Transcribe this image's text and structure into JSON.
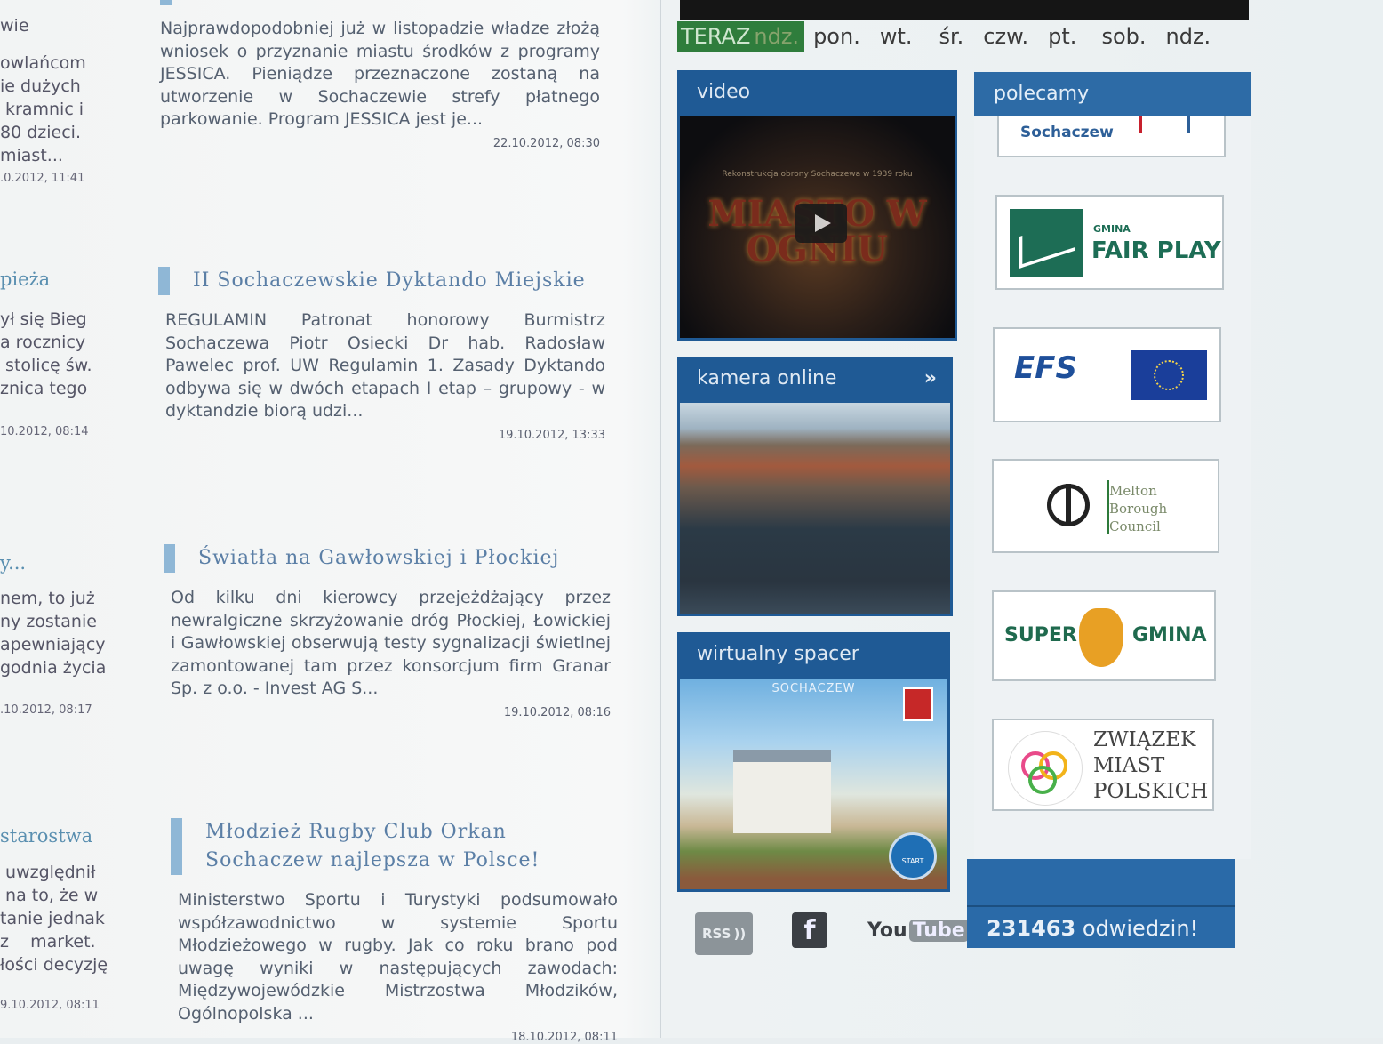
{
  "left_column": {
    "items": [
      {
        "lines": [
          "wie",
          "",
          "owlańcom",
          "ie dużych",
          " kramnic i",
          "80 dzieci.",
          "miast...",
          ""
        ],
        "date": ".0.2012, 11:41"
      },
      {
        "title": "pieża",
        "lines": [
          "ył się Bieg",
          "a rocznicy",
          " stolicę św.",
          "znica tego"
        ],
        "date": "10.2012, 08:14"
      },
      {
        "title": "y...",
        "lines": [
          "nem, to już",
          "ny zostanie",
          "apewniający",
          "godnia życia"
        ],
        "date": ".10.2012, 08:17"
      },
      {
        "title": "starostwa",
        "lines": [
          " uwzględnił",
          " na to, że w",
          "tanie jednak",
          "z    market.",
          "łości decyzję"
        ],
        "date": "9.10.2012, 08:11"
      }
    ]
  },
  "news": [
    {
      "title": "",
      "body": "Najprawdopodobniej już w listopadzie władze złożą wniosek o przyznanie miastu środków z programy JESSICA. Pieniądze przeznaczone zostaną na utworzenie w Sochaczewie strefy płatnego parkowanie. Program JESSICA jest je...",
      "date": "22.10.2012, 08:30"
    },
    {
      "title": "II Sochaczewskie Dyktando Miejskie",
      "body": "REGULAMIN Patronat honorowy Burmistrz Sochaczewa Piotr Osiecki Dr hab. Radosław Pawelec prof. UW  Regulamin  1. Zasady Dyktando odbywa się w dwóch etapach  I etap – grupowy - w dyktandzie biorą udzi...",
      "date": "19.10.2012, 13:33"
    },
    {
      "title": "Światła na Gawłowskiej i Płockiej",
      "body": "Od kilku dni kierowcy przejeżdżający przez newralgiczne skrzyżowanie dróg Płockiej, Łowickiej i Gawłowskiej obserwują testy sygnalizacji świetlnej zamontowanej tam przez konsorcjum firm Granar Sp. z o.o. - Invest AG S...",
      "date": "19.10.2012, 08:16"
    },
    {
      "title": "Młodzież Rugby Club Orkan Sochaczew najlepsza w Polsce!",
      "body": "Ministerstwo Sportu i Turystyki podsumowało współzawodnictwo w systemie Sportu Młodzieżowego w rugby. Jak co roku brano pod uwagę wyniki w następujących zawodach: Międzywojewódzkie Mistrzostwa Młodzików, Ogólnopolska ...",
      "date": "18.10.2012, 08:11"
    }
  ],
  "weather": {
    "now_label": "TERAZ",
    "now_day": "ndz.",
    "days": [
      "pon.",
      "wt.",
      "śr.",
      "czw.",
      "pt.",
      "sob.",
      "ndz."
    ]
  },
  "widgets": {
    "video": {
      "label": "video",
      "caption": "Rekonstrukcja obrony Sochaczewa w 1939 roku",
      "big_text": "MIASTO W OGNIU"
    },
    "camera": {
      "label": "kamera online",
      "arrow": "»"
    },
    "spacer": {
      "label": "wirtualny spacer",
      "town": "SOCHACZEW",
      "start": "START"
    }
  },
  "social": {
    "rss": "RSS",
    "facebook": "f",
    "youtube_you": "You",
    "youtube_tube": "Tube"
  },
  "recommended": {
    "header": "polecamy",
    "banners": {
      "top_partial": "Sochaczew",
      "fairplay_small": "GMINA",
      "fairplay_big": "FAIR PLAY",
      "efs": "EFS",
      "melton": [
        "Melton",
        "Borough",
        "Council"
      ],
      "super": "SUPER",
      "gmina": "GMINA",
      "zmp": [
        "ZWIĄZEK",
        "MIAST",
        "POLSKICH"
      ]
    }
  },
  "stats": {
    "count": "231463",
    "label": "odwiedzin!"
  },
  "colors": {
    "brand_blue": "#1f5a95",
    "accent_light_blue": "#8fb7d6",
    "weather_green": "#2f7d3c"
  }
}
